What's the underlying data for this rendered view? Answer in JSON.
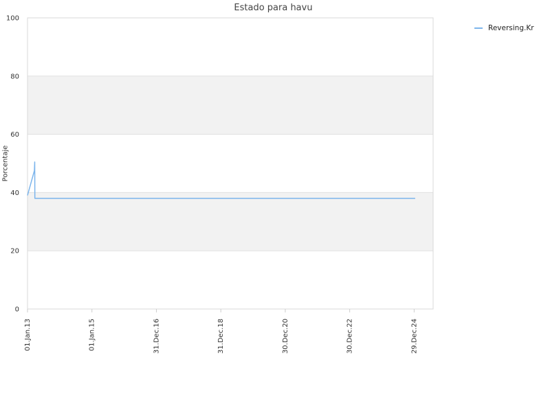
{
  "chart_data": {
    "type": "line",
    "title": "Estado para havu",
    "xlabel": "",
    "ylabel": "Porcentaje",
    "ylim": [
      0,
      100
    ],
    "yticks": [
      0,
      20,
      40,
      60,
      80,
      100
    ],
    "xlim": [
      "2013-01-01",
      "2025-08-01"
    ],
    "xticks": [
      {
        "date": "2013-01-01",
        "label": "01.Jan.13"
      },
      {
        "date": "2015-01-01",
        "label": "01.Jan.15"
      },
      {
        "date": "2016-12-31",
        "label": "31.Dec.16"
      },
      {
        "date": "2018-12-31",
        "label": "31.Dec.18"
      },
      {
        "date": "2020-12-30",
        "label": "30.Dec.20"
      },
      {
        "date": "2022-12-30",
        "label": "30.Dec.22"
      },
      {
        "date": "2024-12-29",
        "label": "29.Dec.24"
      }
    ],
    "grid": true,
    "alternate_bands": true,
    "legend_position": "top-right",
    "series": [
      {
        "name": "Reversing.Kr",
        "color": "#7cb5ec",
        "points": [
          {
            "x": "2013-01-01",
            "y": 39
          },
          {
            "x": "2013-03-15",
            "y": 47
          },
          {
            "x": "2013-03-20",
            "y": 47.5
          },
          {
            "x": "2013-03-24",
            "y": 50.5
          },
          {
            "x": "2013-03-25",
            "y": 38
          },
          {
            "x": "2025-01-10",
            "y": 38
          }
        ]
      }
    ]
  }
}
